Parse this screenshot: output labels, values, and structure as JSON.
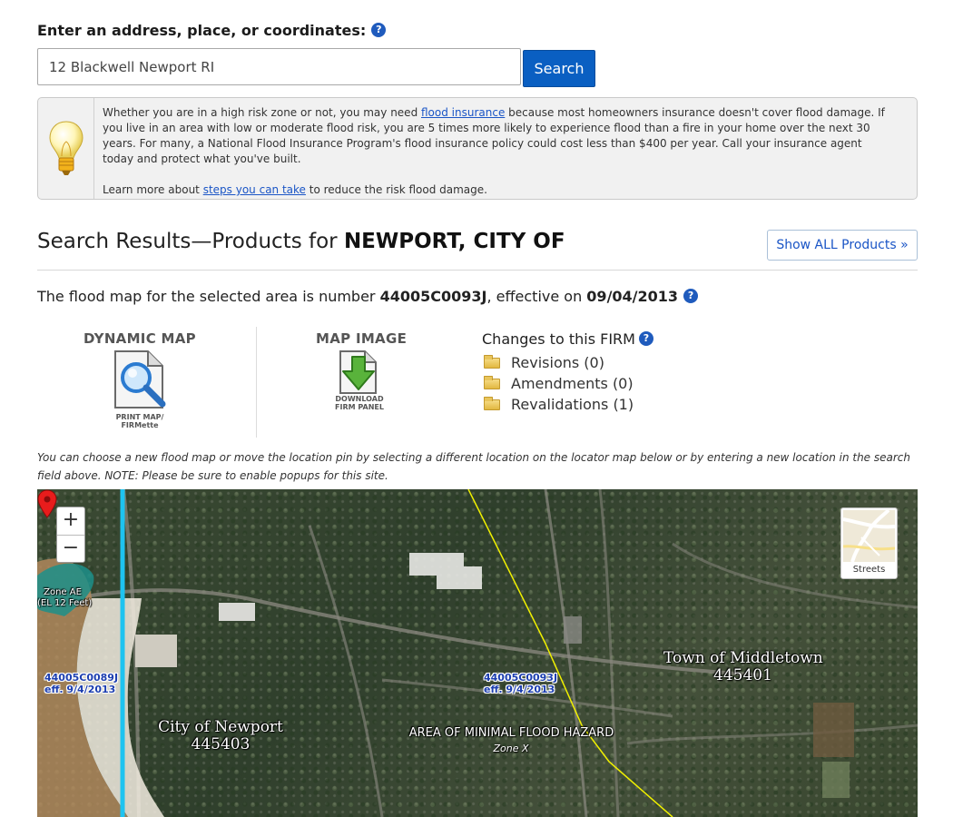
{
  "search": {
    "label": "Enter an address, place, or coordinates:",
    "value": "12 Blackwell Newport RI",
    "button_label": "Search"
  },
  "info": {
    "text_before_link": "Whether you are in a high risk zone or not, you may need ",
    "link_text": "flood insurance",
    "text_after_link": " because most homeowners insurance doesn't cover flood damage. If you live in an area with low or moderate flood risk, you are 5 times more likely to experience flood than a fire in your home over the next 30 years. For many, a National Flood Insurance Program's flood insurance policy could cost less than $400 per year. Call your insurance agent today and protect what you've built.",
    "learn_before": "Learn more about ",
    "learn_link": "steps you can take",
    "learn_after": " to reduce the risk flood damage."
  },
  "results": {
    "title_prefix": "Search Results—Products for ",
    "community": "NEWPORT, CITY OF",
    "show_all_label": "Show ALL Products »"
  },
  "flood_map": {
    "text_before": "The flood map for the selected area is number ",
    "panel_number": "44005C0093J",
    "text_middle": ", effective on ",
    "effective_date": "09/04/2013"
  },
  "products": {
    "dynamic_map_title": "DYNAMIC MAP",
    "dynamic_map_caption_1": "PRINT MAP/",
    "dynamic_map_caption_2": "FIRMette",
    "map_image_title": "MAP IMAGE",
    "map_image_caption_1": "DOWNLOAD",
    "map_image_caption_2": "FIRM PANEL"
  },
  "changes": {
    "title": "Changes to this FIRM",
    "items": [
      {
        "label": "Revisions (0)"
      },
      {
        "label": "Amendments (0)"
      },
      {
        "label": "Revalidations (1)"
      }
    ]
  },
  "note": "You can choose a new flood map or move the location pin by selecting a different location on the locator map below or by entering a new location in the search field above. NOTE: Please be sure to enable popups for this site.",
  "map": {
    "zoom_in": "+",
    "zoom_out": "−",
    "basemap_label": "Streets",
    "labels": {
      "zone_ae_1": "Zone AE",
      "zone_ae_2": "(EL 12 Feet)",
      "panel_left_1": "44005C0089J",
      "panel_left_2": "eff. 9/4/2013",
      "panel_right_1": "44005C0093J",
      "panel_right_2": "eff. 9/4/2013",
      "newport_1": "City of Newport",
      "newport_2": "445403",
      "middletown_1": "Town of Middletown",
      "middletown_2": "445401",
      "minimal_hazard": "AREA OF MINIMAL FLOOD HAZARD",
      "zone_x": "Zone X"
    },
    "colors": {
      "panel_line": "#1ec3f0",
      "boundary_line": "#f0f000",
      "zone_ae": "#1c8f8a",
      "pin": "#e81c1c"
    }
  },
  "icons": [
    "help-icon",
    "lightbulb-icon",
    "magnifier-map-icon",
    "download-arrow-icon",
    "folder-icon",
    "map-pin-icon"
  ]
}
